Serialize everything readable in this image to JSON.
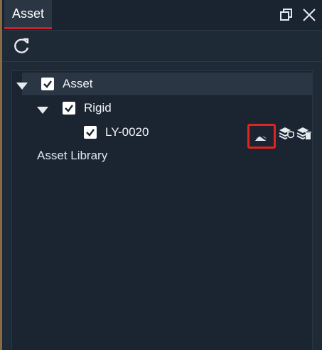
{
  "tab": {
    "title": "Asset"
  },
  "window_controls": {
    "restore_icon": "restore-icon",
    "close_icon": "close-icon"
  },
  "toolbar": {
    "refresh_icon": "refresh-icon"
  },
  "tree": {
    "root": {
      "label": "Asset",
      "checked": true,
      "expanded": true
    },
    "group": {
      "label": "Rigid",
      "checked": true,
      "expanded": true
    },
    "item": {
      "label": "LY-0020",
      "checked": true,
      "actions": [
        "hide-icon",
        "layers-shield-icon",
        "layers-delete-icon"
      ]
    }
  },
  "library_link": "Asset Library",
  "colors": {
    "accent": "#c8202e",
    "highlight": "#e3231c",
    "background": "#1f2a37"
  }
}
